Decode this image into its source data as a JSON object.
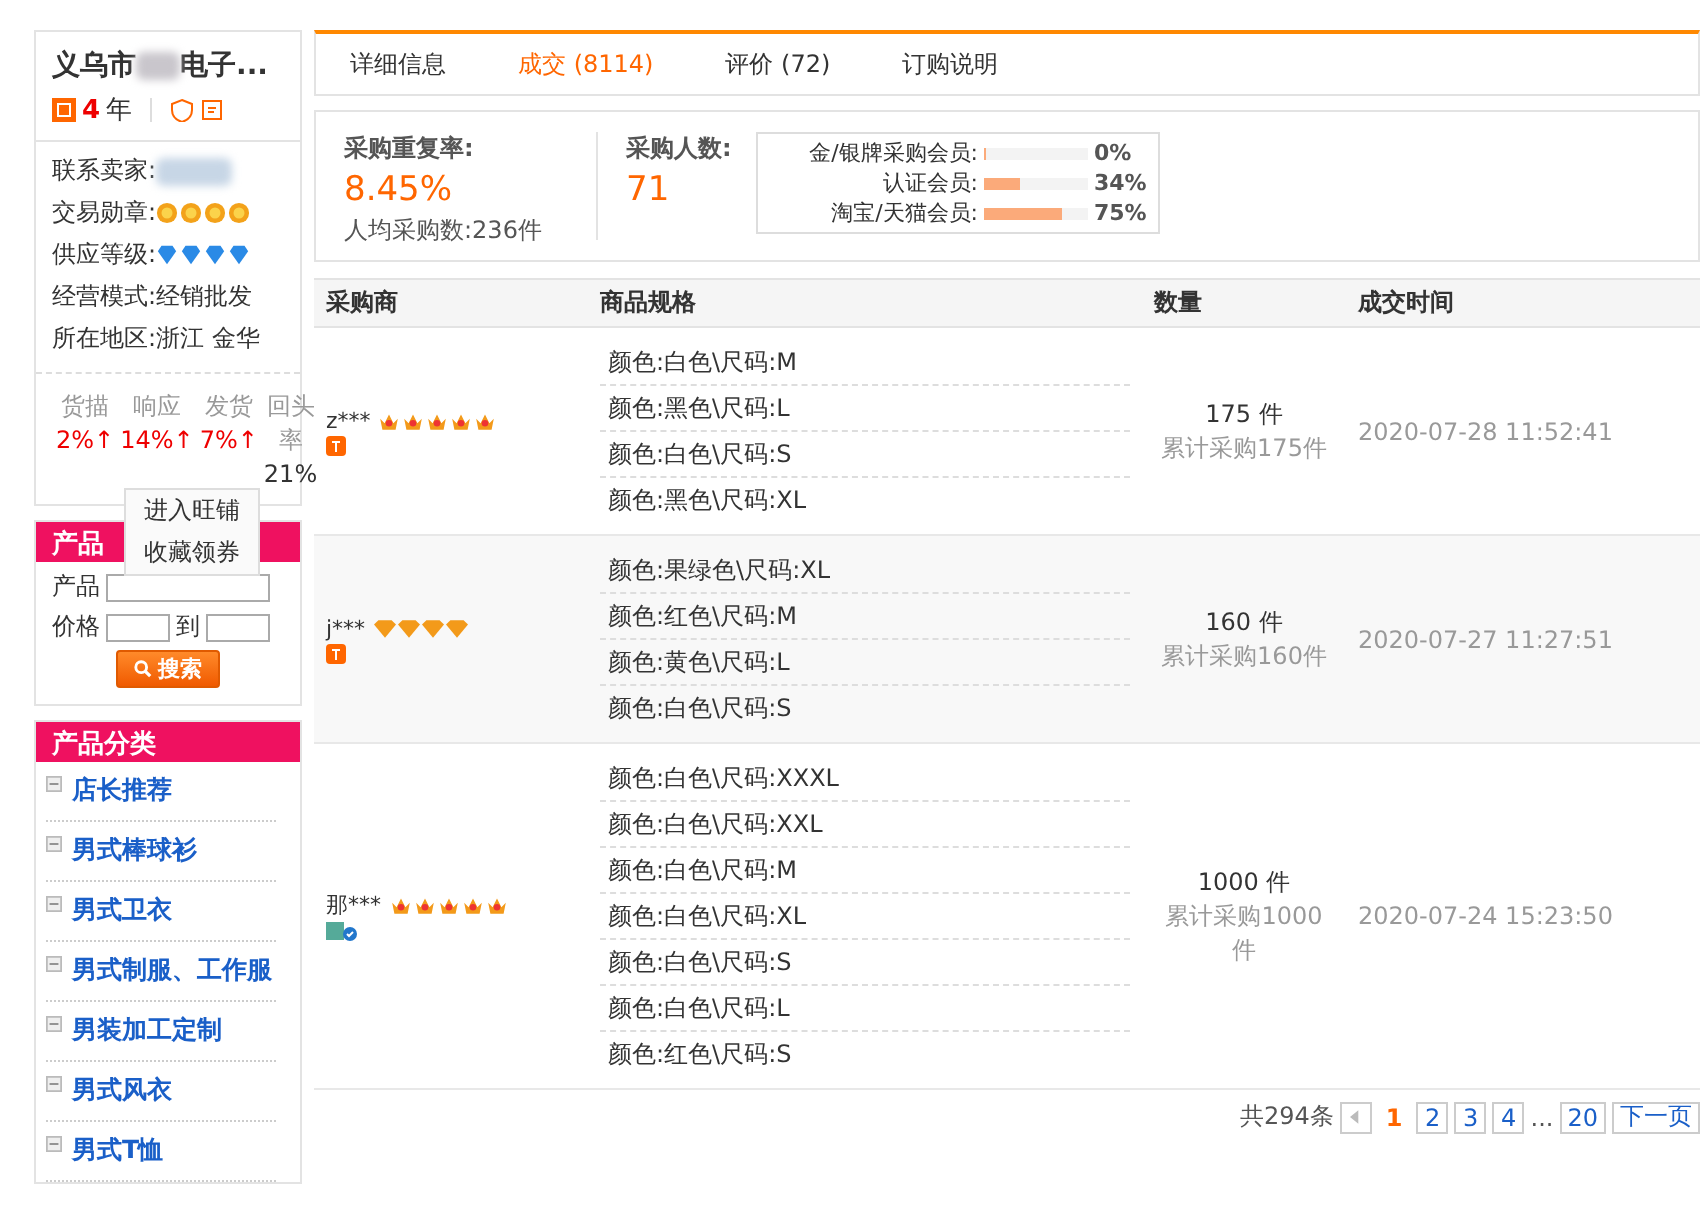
{
  "shop": {
    "name_start": "义乌市",
    "name_end": "电子...",
    "years_number": "4",
    "years_unit": "年",
    "info": [
      {
        "kind": "blur",
        "label": "联系卖家:"
      },
      {
        "kind": "medals",
        "label": "交易勋章:",
        "stars": 4
      },
      {
        "kind": "diamonds",
        "label": "供应等级:",
        "stars": 4
      },
      {
        "kind": "text",
        "label": "经营模式:",
        "value": "经销批发"
      },
      {
        "kind": "text",
        "label": "所在地区:",
        "value": "浙江 金华"
      }
    ],
    "scores": [
      {
        "label": "货描",
        "value": "2%↑"
      },
      {
        "label": "响应",
        "value": "14%↑"
      },
      {
        "label": "发货",
        "value": "7%↑"
      }
    ],
    "repeat_label": "回头率",
    "repeat_value": "21%",
    "menu": [
      "进入旺铺",
      "收藏领券"
    ]
  },
  "product_search": {
    "title": "产品",
    "product_label": "产品",
    "price_label": "价格",
    "to_label": "到",
    "button": "搜索"
  },
  "categories": {
    "title": "产品分类",
    "items": [
      "店长推荐",
      "男式棒球衫",
      "男式卫衣",
      "男式制服、工作服",
      "男装加工定制",
      "男式风衣",
      "男式T恤"
    ]
  },
  "tabs": [
    {
      "label": "详细信息",
      "selected": false
    },
    {
      "label": "成交 (8114)",
      "selected": true
    },
    {
      "label": "评价 (72)",
      "selected": false
    },
    {
      "label": "订购说明",
      "selected": false
    }
  ],
  "summary": {
    "repeat_label": "采购重复率:",
    "repeat_value": "8.45%",
    "avg_label": "人均采购数:",
    "avg_value": "236件",
    "buyers_label": "采购人数:",
    "buyers_value": "71",
    "breakdown": [
      {
        "label": "金/银牌采购会员:",
        "level": 0,
        "reading": "0%"
      },
      {
        "label": "认证会员:",
        "level": 0.34,
        "reading": "34%"
      },
      {
        "label": "淘宝/天猫会员:",
        "level": 0.75,
        "reading": "75%"
      }
    ]
  },
  "table": {
    "columns": [
      "采购商",
      "商品规格",
      "数量",
      "成交时间"
    ],
    "rows": [
      {
        "buyer": "z***",
        "rating": {
          "kind": "crown",
          "stars": 5
        },
        "tag": {
          "kind": "taobao"
        },
        "specs": [
          "颜色:白色\\尺码:M",
          "颜色:黑色\\尺码:L",
          "颜色:白色\\尺码:S",
          "颜色:黑色\\尺码:XL"
        ],
        "quantity": "175 件",
        "total": "累计采购175件",
        "time": "2020-07-28 11:52:41"
      },
      {
        "buyer": "j***",
        "rating": {
          "kind": "diamond",
          "stars": 4
        },
        "tag": {
          "kind": "taobao"
        },
        "specs": [
          "颜色:果绿色\\尺码:XL",
          "颜色:红色\\尺码:M",
          "颜色:黄色\\尺码:L",
          "颜色:白色\\尺码:S"
        ],
        "quantity": "160 件",
        "total": "累计采购160件",
        "time": "2020-07-27 11:27:51"
      },
      {
        "buyer": "那***",
        "rating": {
          "kind": "crown",
          "stars": 5
        },
        "tag": {
          "kind": "verified"
        },
        "specs": [
          "颜色:白色\\尺码:XXXL",
          "颜色:白色\\尺码:XXL",
          "颜色:白色\\尺码:M",
          "颜色:白色\\尺码:XL",
          "颜色:白色\\尺码:S",
          "颜色:白色\\尺码:L",
          "颜色:红色\\尺码:S"
        ],
        "quantity": "1000 件",
        "total": "累计采购1000件",
        "time": "2020-07-24 15:23:50"
      }
    ]
  },
  "pagination": {
    "total": "共294条",
    "pages": [
      {
        "label": "1",
        "selected": true
      },
      {
        "label": "2",
        "selected": false
      },
      {
        "label": "3",
        "selected": false
      },
      {
        "label": "4",
        "selected": false
      }
    ],
    "ellipsis": "...",
    "last": "20",
    "next": "下一页"
  }
}
